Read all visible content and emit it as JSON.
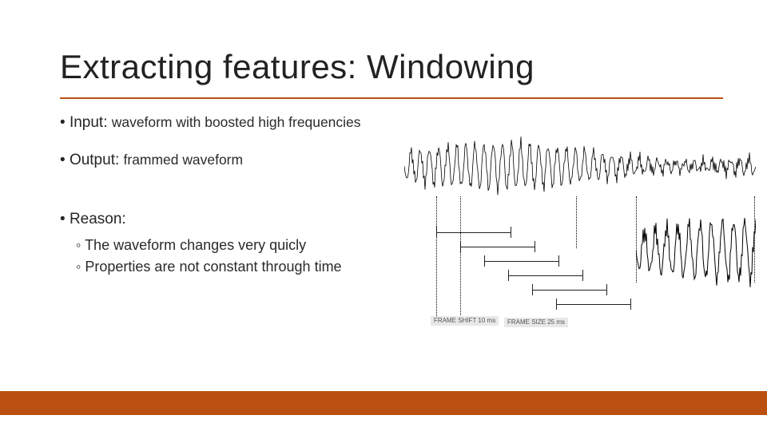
{
  "title": "Extracting features: Windowing",
  "input": {
    "label": "Input:",
    "text": "waveform with boosted high frequencies"
  },
  "output": {
    "label": "Output:",
    "text": "frammed waveform"
  },
  "reason": {
    "label": "Reason:",
    "items": [
      "The waveform changes very quicly",
      "Properties are not constant through time"
    ]
  },
  "figure": {
    "frame_shift_label": "FRAME\nSHIFT\n10 ms",
    "frame_size_label": "FRAME SIZE\n25 ms"
  }
}
